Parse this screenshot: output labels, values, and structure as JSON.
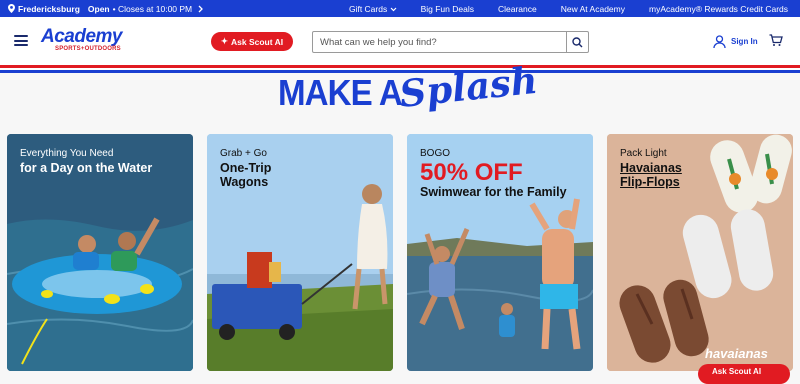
{
  "topbar": {
    "store": "Fredericksburg",
    "status": "Open",
    "hours": "• Closes at 10:00 PM",
    "links": [
      "Gift Cards",
      "Big Fun Deals",
      "Clearance",
      "New At Academy",
      "myAcademy® Rewards Credit Cards"
    ]
  },
  "header": {
    "logo": "Academy",
    "logo_sub": "SPORTS+OUTDOORS",
    "scout_label": "Ask Scout AI",
    "search_placeholder": "What can we help you find?",
    "signin_label": "Sign In"
  },
  "hero": {
    "title_a": "MAKE A",
    "title_b": "Splash"
  },
  "cards": [
    {
      "line1": "Everything You Need",
      "line2": "for a Day on the Water"
    },
    {
      "line1": "Grab + Go",
      "line2": "One-Trip",
      "line3": "Wagons"
    },
    {
      "line1": "BOGO",
      "line2": "50% OFF",
      "line3": "Swimwear for the Family"
    },
    {
      "line1": "Pack Light",
      "line2": "Havaianas",
      "line3": "Flip-Flops",
      "brand": "havaianas"
    }
  ],
  "chat": {
    "label": "Ask Scout AI"
  },
  "colors": {
    "brand_blue": "#1a3fd1",
    "accent_red": "#e11b22"
  }
}
